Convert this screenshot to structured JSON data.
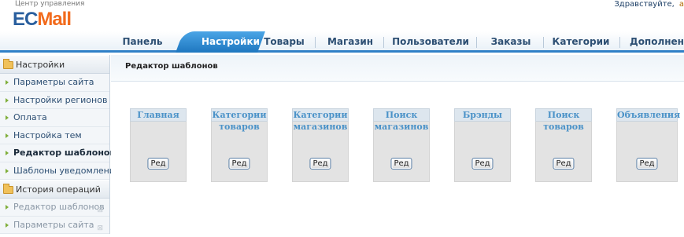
{
  "header": {
    "subtitle": "Центр управления",
    "logo_ec": "EC",
    "logo_mall": "Mall",
    "greeting": "Здравствуйте,",
    "user": "a"
  },
  "nav": {
    "items": [
      {
        "label": "Панель"
      },
      {
        "label": "Настройки"
      },
      {
        "label": "Товары"
      },
      {
        "label": "Магазин"
      },
      {
        "label": "Пользователи"
      },
      {
        "label": "Заказы"
      },
      {
        "label": "Категории"
      },
      {
        "label": "Дополнения"
      }
    ],
    "active_index": 1
  },
  "sidebar": {
    "settings_title": "Настройки",
    "settings_items": [
      {
        "label": "Параметры сайта"
      },
      {
        "label": "Настройки регионов"
      },
      {
        "label": "Оплата"
      },
      {
        "label": "Настройка тем"
      },
      {
        "label": "Редактор шаблонов"
      },
      {
        "label": "Шаблоны уведомлений"
      }
    ],
    "current_index": 4,
    "history_title": "История операций",
    "history_items": [
      {
        "label": "Редактор шаблонов",
        "close": "⊠"
      },
      {
        "label": "Параметры сайта",
        "close": "⊠"
      }
    ]
  },
  "main": {
    "title": "Редактор шаблонов",
    "templates": [
      {
        "title": "Главная",
        "sub": "",
        "button": "Ред"
      },
      {
        "title": "Категории",
        "sub": "товаров",
        "button": "Ред"
      },
      {
        "title": "Категории",
        "sub": "магазинов",
        "button": "Ред"
      },
      {
        "title": "Поиск",
        "sub": "магазинов",
        "button": "Ред"
      },
      {
        "title": "Брэнды",
        "sub": "",
        "button": "Ред"
      },
      {
        "title": "Поиск",
        "sub": "товаров",
        "button": "Ред"
      },
      {
        "title": "Объявления",
        "sub": "",
        "button": "Ред"
      }
    ]
  }
}
